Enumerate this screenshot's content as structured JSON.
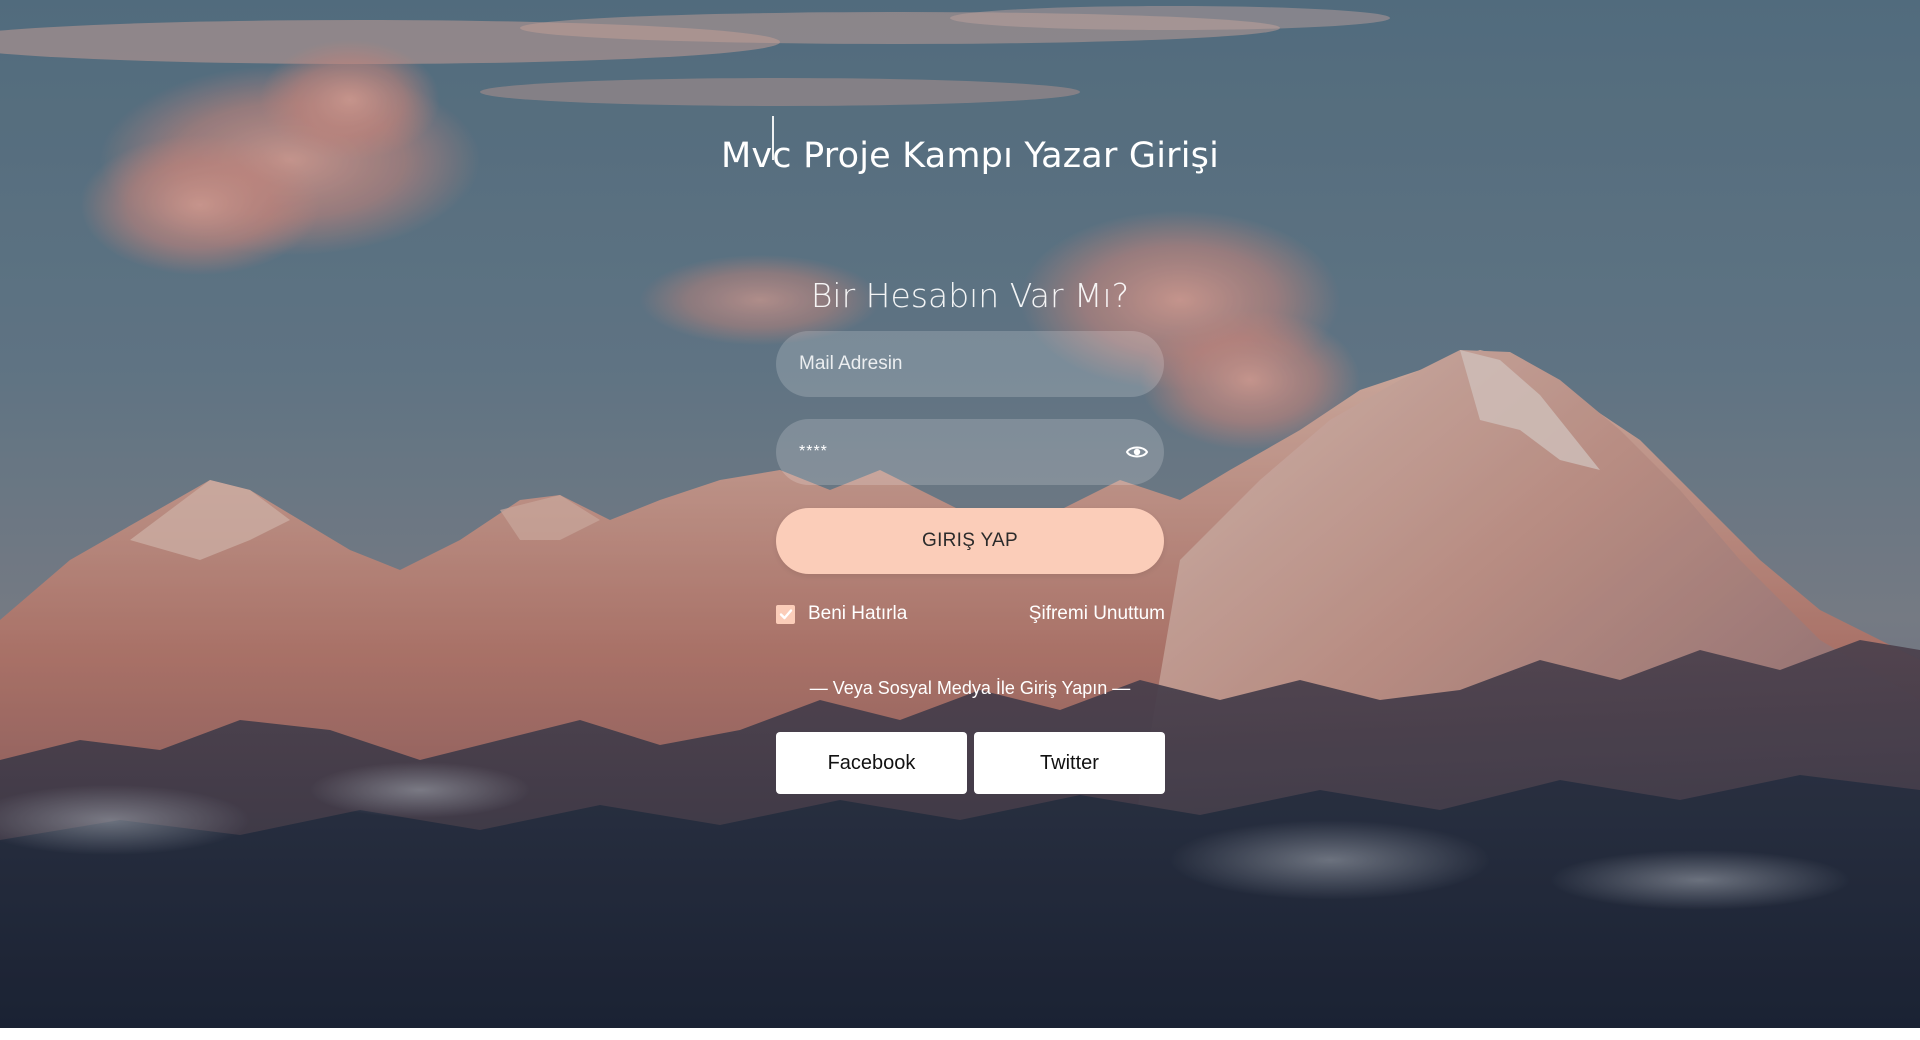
{
  "page": {
    "title": "Mvc Proje Kampı Yazar Girişi",
    "subtitle": "Bir Hesabın Var Mı?"
  },
  "form": {
    "email": {
      "placeholder": "Mail Adresin",
      "value": ""
    },
    "password": {
      "value": "****",
      "icon": "eye-icon"
    },
    "login_label": "GIRIŞ YAP",
    "remember_label": "Beni Hatırla",
    "remember_checked": true,
    "forgot_label": "Şifremi Unuttum"
  },
  "social": {
    "divider_label": "— Veya Sosyal Medya İle Giriş Yapın —",
    "facebook_label": "Facebook",
    "twitter_label": "Twitter"
  },
  "colors": {
    "accent": "#fbcdb9",
    "text": "#ffffff",
    "social_button_bg": "#ffffff"
  }
}
